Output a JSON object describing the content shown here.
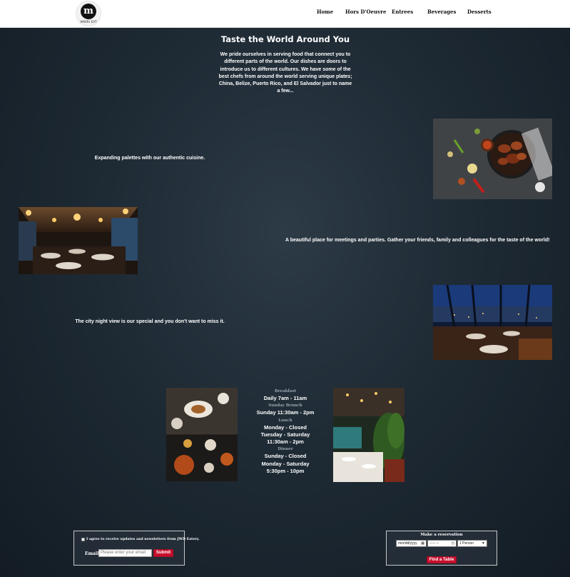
{
  "brand": {
    "logo_text": "AMARI EAT"
  },
  "nav": {
    "home": "Home",
    "hors": "Hors D'Oeuvre",
    "entrees": "Entrees",
    "beverages": "Beverages",
    "desserts": "Desserts"
  },
  "hero": {
    "title": "Taste the World Around You",
    "intro": "We pride ourselves in serving food that connect you to different parts of the world. Our dishes are doors to introduce us to different cultures. We have some of the best chefs from around the world serving unique plates; China, Belize, Puerto Rico, and El Salvador just to name a few..."
  },
  "features": {
    "cuisine": "Expanding palettes with our authentic cuisine.",
    "meetings": "A beautiful place for meetings and parties. Gather your friends, family and colleagues for the taste of the world!",
    "night_view": "The city night view is our special and you don't want to miss it."
  },
  "hours": {
    "breakfast_label": "Breakfast",
    "breakfast_time": "Daily 7am - 11am",
    "brunch_label": "Sunday Brunch",
    "brunch_time": "Sunday 11:30am - 2pm",
    "lunch_label": "Lunch",
    "lunch_time_1": "Monday - Closed",
    "lunch_time_2": "Tuesday - Saturday",
    "lunch_time_3": "11:30am - 2pm",
    "dinner_label": "Dinner",
    "dinner_time_1": "Sunday - Closed",
    "dinner_time_2": "Monday - Saturday",
    "dinner_time_3": "5:30pm - 10pm"
  },
  "newsletter": {
    "consent": "I agree to receive updates and newsletters from JWD Eatery.",
    "email_label": "Email",
    "email_placeholder": "Please enter your email",
    "submit_label": "Submit"
  },
  "reservation": {
    "title": "Make a reservation",
    "date_value": "mm/dd/yyyy",
    "time_value": "--:-- --",
    "party_value": "1 Person",
    "button_label": "Find a Table"
  },
  "colors": {
    "accent": "#c8102e",
    "nav_bg": "#ffffff",
    "page_bg": "#1e2a34"
  }
}
